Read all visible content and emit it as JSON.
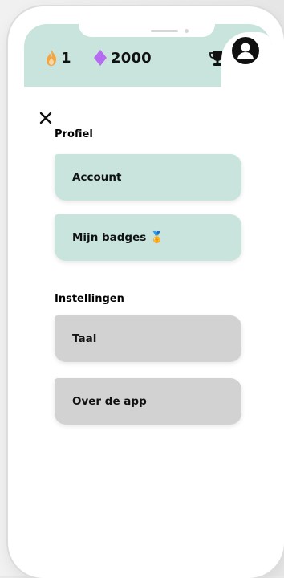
{
  "header": {
    "streak_count": "1",
    "gem_count": "2000",
    "icons": [
      "flame-icon",
      "diamond-icon",
      "trophy-icon",
      "user-avatar-icon"
    ]
  },
  "menu": {
    "close_icon": "close-icon",
    "sections": [
      {
        "title": "Profiel",
        "items": [
          {
            "label": "Account"
          },
          {
            "label": "Mijn badges 🏅"
          }
        ]
      },
      {
        "title": "Instellingen",
        "items": [
          {
            "label": "Taal"
          },
          {
            "label": "Over de app"
          }
        ]
      }
    ]
  },
  "colors": {
    "mint": "#c8e4dd",
    "grey_card": "#d2d2d2",
    "flame": "#f2a540",
    "gem": "#b56cf0"
  }
}
